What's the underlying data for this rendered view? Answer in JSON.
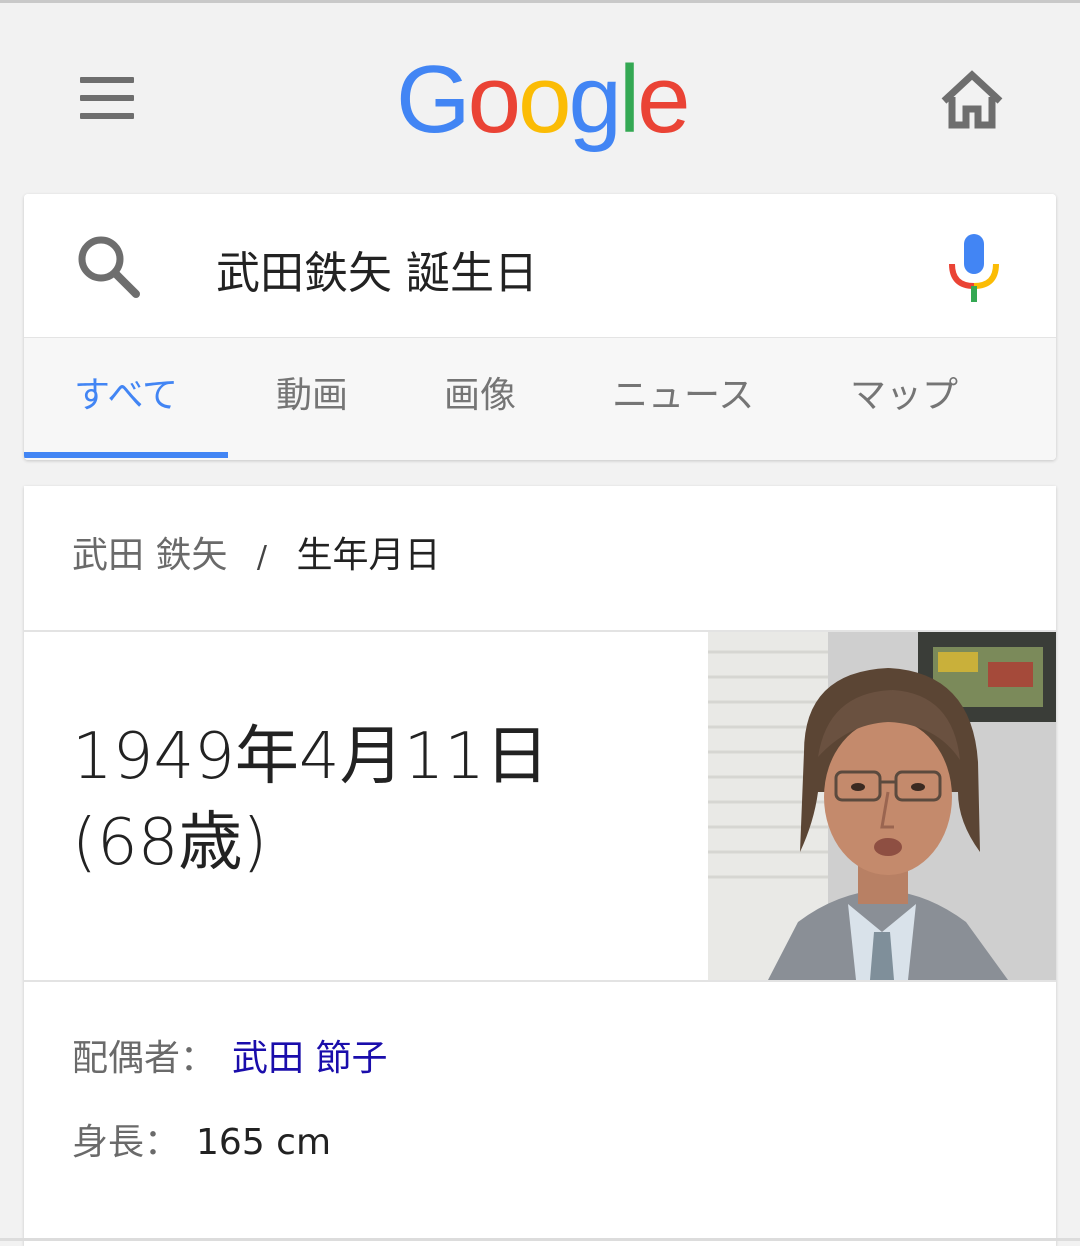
{
  "header": {
    "logo": {
      "letters": [
        "G",
        "o",
        "o",
        "g",
        "l",
        "e"
      ],
      "colors": [
        "#4285F4",
        "#EA4335",
        "#FBBC05",
        "#4285F4",
        "#34A853",
        "#EA4335"
      ]
    },
    "menu_icon": "hamburger-menu-icon",
    "home_icon": "home-icon"
  },
  "search": {
    "query": "武田鉄矢 誕生日",
    "search_icon": "search-icon",
    "mic_icon": "microphone-icon"
  },
  "tabs": [
    {
      "label": "すべて",
      "active": true
    },
    {
      "label": "動画",
      "active": false
    },
    {
      "label": "画像",
      "active": false
    },
    {
      "label": "ニュース",
      "active": false
    },
    {
      "label": "マップ",
      "active": false
    }
  ],
  "knowledge": {
    "entity": "武田 鉄矢",
    "separator": "/",
    "attribute": "生年月日",
    "answer_line1": "1949年4月11日",
    "answer_line2": "(68歳)",
    "facts": [
      {
        "label": "配偶者：",
        "value": "武田 節子",
        "is_link": true
      },
      {
        "label": "身長：",
        "value": "165 cm",
        "is_link": false
      }
    ]
  },
  "colors": {
    "accent": "#4285F4",
    "link": "#1A0DAB",
    "background": "#F2F2F2"
  }
}
